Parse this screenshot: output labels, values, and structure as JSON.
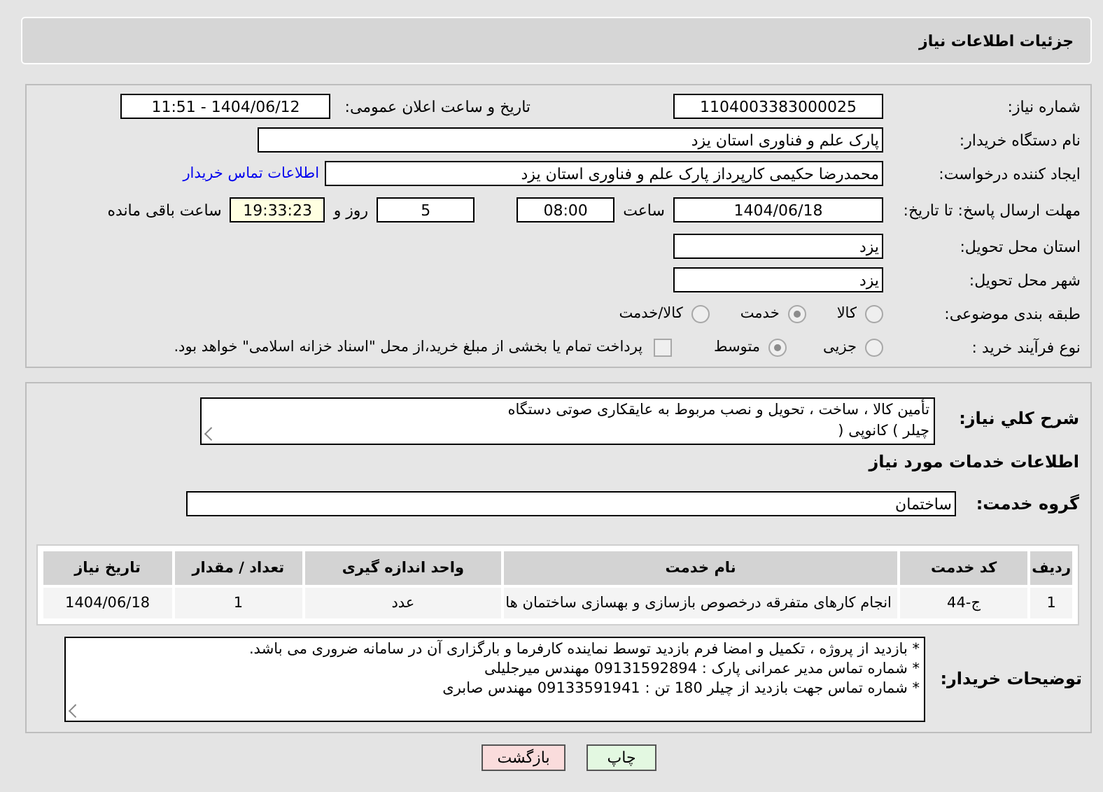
{
  "header": {
    "title": "جزئیات اطلاعات نیاز"
  },
  "need_number": {
    "label": "شماره نیاز:",
    "value": "1104003383000025"
  },
  "announce_datetime": {
    "label": "تاریخ و ساعت اعلان عمومی:",
    "value": "1404/06/12 - 11:51"
  },
  "buyer_org": {
    "label": "نام دستگاه خریدار:",
    "value": "پارک علم و فناوری استان یزد"
  },
  "requester": {
    "label": "ایجاد کننده درخواست:",
    "value": "محمدرضا  حکیمی کارپرداز پارک علم و فناوری استان یزد",
    "link": "اطلاعات تماس خریدار"
  },
  "deadline": {
    "label": "مهلت ارسال پاسخ: تا تاریخ:",
    "date": "1404/06/18",
    "time_label": "ساعت",
    "time": "08:00",
    "days": "5",
    "days_label": "روز و",
    "remaining": "19:33:23",
    "remaining_label": "ساعت باقی مانده"
  },
  "province": {
    "label": "استان محل تحویل:",
    "value": "یزد"
  },
  "city": {
    "label": "شهر محل تحویل:",
    "value": "یزد"
  },
  "category": {
    "label": "طبقه بندی موضوعی:",
    "options": [
      {
        "label": "کالا",
        "selected": false
      },
      {
        "label": "خدمت",
        "selected": true
      },
      {
        "label": "کالا/خدمت",
        "selected": false
      }
    ]
  },
  "purchase_type": {
    "label": "نوع فرآیند خرید :",
    "options": [
      {
        "label": "جزیی",
        "selected": false
      },
      {
        "label": "متوسط",
        "selected": true
      }
    ],
    "treasury": {
      "checked": false,
      "text": "پرداخت تمام یا بخشی از مبلغ خرید،از محل \"اسناد خزانه اسلامی\" خواهد بود."
    }
  },
  "description": {
    "label": "شرح کلي نياز:",
    "lines": [
      "تأمین کالا ، ساخت ، تحویل و نصب مربوط به عایقکاری صوتی دستگاه",
      "چیلر ) کانوپی ("
    ]
  },
  "services_heading": "اطلاعات خدمات مورد نیاز",
  "service_group": {
    "label": "گروه خدمت:",
    "value": "ساختمان"
  },
  "table": {
    "columns": [
      "ردیف",
      "کد خدمت",
      "نام خدمت",
      "واحد اندازه گیری",
      "تعداد / مقدار",
      "تاریخ نیاز"
    ],
    "rows": [
      [
        "1",
        "ج-44",
        "انجام کارهای متفرقه درخصوص بازسازی و بهسازی ساختمان ها",
        "عدد",
        "1",
        "1404/06/18"
      ]
    ]
  },
  "buyer_notes": {
    "label": "توضیحات خریدار:",
    "lines": [
      "* بازدید از پروژه ، تکمیل و امضا فرم بازدید توسط نماینده کارفرما و بارگزاری آن در سامانه ضروری می باشد.",
      "* شماره تماس مدیر عمرانی پارک : 09131592894 مهندس میرجلیلی",
      "* شماره تماس جهت بازدید از چیلر 180 تن : 09133591941 مهندس صابری"
    ]
  },
  "buttons": [
    {
      "label": "چاپ",
      "kind": "print"
    },
    {
      "label": "بازگشت",
      "kind": "back"
    }
  ]
}
